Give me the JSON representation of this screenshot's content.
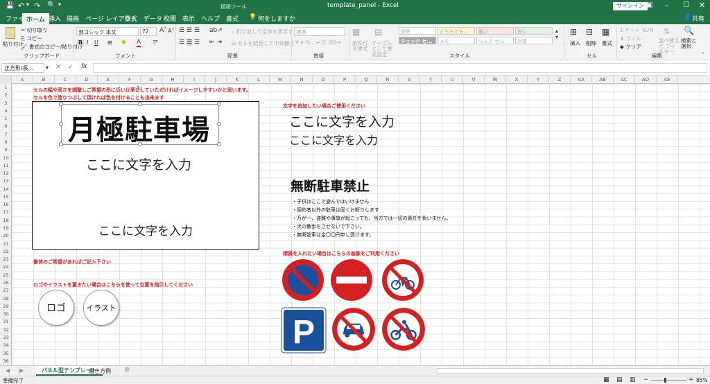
{
  "titlebar": {
    "contextual": "描画ツール",
    "file_title": "template_panel  -  Excel",
    "signin": "サインイン"
  },
  "tabs": [
    {
      "id": "file",
      "label": "ファイル"
    },
    {
      "id": "home",
      "label": "ホーム"
    },
    {
      "id": "insert",
      "label": "挿入"
    },
    {
      "id": "draw",
      "label": "描画"
    },
    {
      "id": "layout",
      "label": "ページ レイアウト"
    },
    {
      "id": "formulas",
      "label": "数式"
    },
    {
      "id": "data",
      "label": "データ"
    },
    {
      "id": "review",
      "label": "校閲"
    },
    {
      "id": "view",
      "label": "表示"
    },
    {
      "id": "help",
      "label": "ヘルプ"
    },
    {
      "id": "format",
      "label": "書式"
    }
  ],
  "tell_me": "何をしますか",
  "share": "共有",
  "ribbon": {
    "paste": "貼り付け",
    "cut": "切り取り",
    "copy": "コピー",
    "format_painter": "書式のコピー/貼り付け",
    "clipboard_label": "クリップボード",
    "font_name": "游ゴシック 本文",
    "font_size": "72",
    "font_label": "フォント",
    "wrap_text": "折り返して全体を表示する",
    "merge_center": "セルを結合して中央揃え",
    "align_label": "配置",
    "number_format": "標準",
    "number_label": "数値",
    "cond_format": "条件付き書式",
    "table_format": "テーブルとして書式設定",
    "styles": [
      "標準",
      "どちらでも...",
      "悪い",
      "良い",
      "チェック セ...",
      "メモ",
      "リンク セル",
      "計算"
    ],
    "style_label": "スタイル",
    "insert": "挿入",
    "delete": "削除",
    "format": "書式",
    "cells_label": "セル",
    "autosum": "オート SUM",
    "fill": "フィル",
    "clear": "クリア",
    "sort_filter": "並べ替えと フィルター",
    "find_select": "検索と 選択",
    "edit_label": "編集"
  },
  "formula": {
    "name_box": "正方形/長...",
    "fx": "fx"
  },
  "columns": [
    "A",
    "B",
    "C",
    "D",
    "E",
    "F",
    "G",
    "H",
    "I",
    "J",
    "K",
    "L",
    "M",
    "N",
    "O",
    "P",
    "Q",
    "R",
    "S",
    "T",
    "U",
    "V",
    "W",
    "X",
    "Y",
    "Z",
    "AA",
    "AB",
    "AC",
    "AD",
    "AE"
  ],
  "rows": [
    "1",
    "2",
    "3",
    "4",
    "5",
    "6",
    "7",
    "8",
    "9",
    "10",
    "11",
    "12",
    "13",
    "14",
    "15",
    "16",
    "17",
    "18",
    "19",
    "20",
    "21",
    "22",
    "23",
    "24",
    "25",
    "26",
    "27",
    "28",
    "29",
    "30",
    "31",
    "32",
    "33",
    "34",
    "35",
    "36"
  ],
  "sheet": {
    "note_row1": "セルの幅や高さを調整しご希望の形に近い比率にしていただければイメージしやすいかと思います。",
    "note_row2": "セルを色で塗りつぶして頂ければ色を付けることも出来ます",
    "panel_title": "月極駐車場",
    "panel_line1": "ここに文字を入力",
    "panel_line2": "ここに文字を入力",
    "text_note": "文字を追加したい場合ご使用ください",
    "text_big": "ここに文字を入力",
    "text_mid": "ここに文字を入力",
    "no_parking_title": "無断駐車禁止",
    "rules": [
      "・子供はここで遊んではいけません",
      "・契約者以外の駐車は固くお断りします",
      "・万が一、盗難や事故が起こっても、当方では一切の責任を負いません。",
      "・犬の散歩をさせないで下さい。",
      "・無断駐車は金〇〇円申し受けます。"
    ],
    "font_note": "書体のご希望があればご記入下さい",
    "logo_note": "ロゴやイラストを置きたい場合はこちらを使って位置を指示してください",
    "logo_btn": "ロゴ",
    "illust_btn": "イラスト",
    "sign_note": "標識を入れたい場合はこちらの画像をご利用ください",
    "parking_letter": "P"
  },
  "sheet_tabs": [
    "パネル型テンプレート",
    "書き方例"
  ],
  "status": {
    "ready": "準備完了",
    "zoom": "85%"
  },
  "colors": {
    "excel_green": "#217346",
    "sign_red": "#d42020",
    "sign_blue": "#1a4f9c",
    "note_red": "#d02020"
  }
}
